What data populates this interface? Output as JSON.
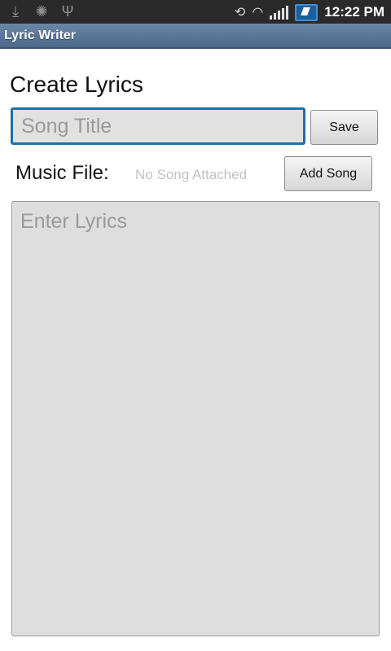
{
  "status_bar": {
    "left_icons": [
      "download-icon",
      "android-debug-icon",
      "usb-icon"
    ],
    "right_icons": [
      "rotation-icon",
      "wifi-icon",
      "signal-icon",
      "battery-charging-icon"
    ],
    "time": "12:22 PM"
  },
  "app": {
    "title": "Lyric Writer"
  },
  "main": {
    "heading": "Create Lyrics",
    "song_title": {
      "placeholder": "Song Title",
      "value": ""
    },
    "save_label": "Save",
    "music_label": "Music File:",
    "song_status": "No Song Attached",
    "add_song_label": "Add Song",
    "lyrics": {
      "placeholder": "Enter Lyrics",
      "value": ""
    }
  },
  "colors": {
    "title_bar": "#5b7697",
    "focus_border": "#1e6fa8",
    "input_background": "#e1e1e1"
  }
}
